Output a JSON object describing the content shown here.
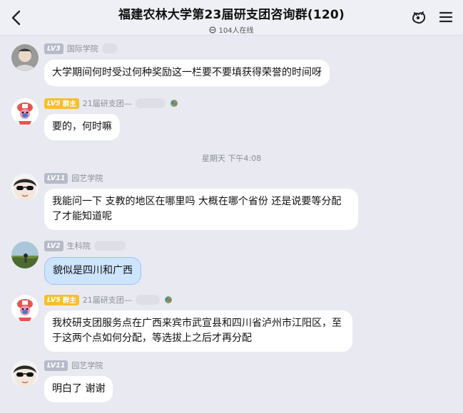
{
  "header": {
    "title": "福建农林大学第23届研支团咨询群(120)",
    "online": "104人在线"
  },
  "timestamp": "星期天 下午4:08",
  "messages": [
    {
      "level": "LV3",
      "role": "",
      "sender": "国际学院",
      "text": "大学期间何时受过何种奖励这一栏要不要填获得荣誉的时间呀"
    },
    {
      "level": "LV5",
      "role": "群主",
      "sender": "21届研支团—",
      "text": "要的，何时嘛"
    },
    {
      "level": "LV11",
      "role": "",
      "sender": "园艺学院",
      "text": "我能问一下 支教的地区在哪里吗 大概在哪个省份 还是说要等分配了才能知道呢"
    },
    {
      "level": "LV2",
      "role": "",
      "sender": "生科院",
      "text": "貌似是四川和广西"
    },
    {
      "level": "LV5",
      "role": "群主",
      "sender": "21届研支团—",
      "text": "我校研支团服务点在广西来宾市武宣县和四川省泸州市江阳区，至于这两个点如何分配，等选拔上之后才再分配"
    },
    {
      "level": "LV11",
      "role": "",
      "sender": "园艺学院",
      "text": "明白了 谢谢"
    }
  ]
}
